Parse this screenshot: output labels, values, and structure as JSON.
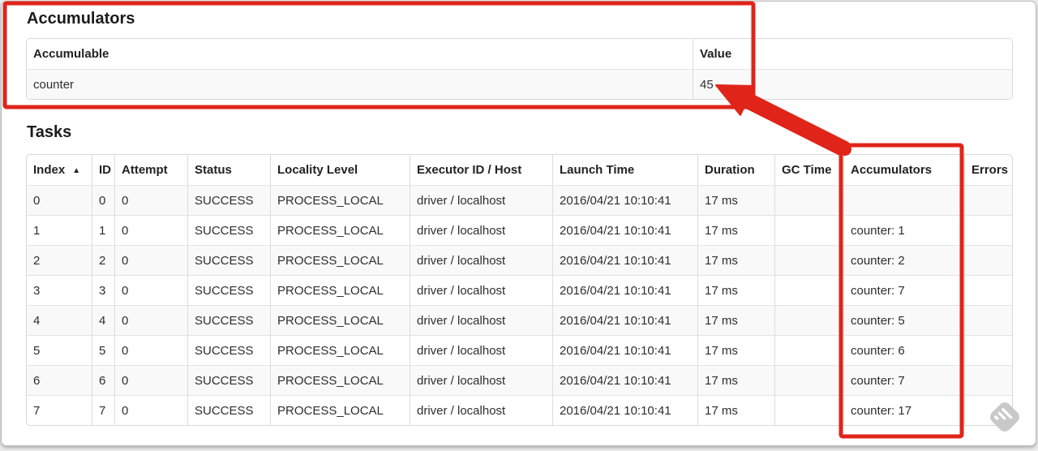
{
  "accumulators_section": {
    "title": "Accumulators",
    "table": {
      "headers": [
        "Accumulable",
        "Value"
      ],
      "rows": [
        [
          "counter",
          "45"
        ]
      ]
    }
  },
  "tasks_section": {
    "title": "Tasks",
    "table": {
      "headers": [
        "Index",
        "ID",
        "Attempt",
        "Status",
        "Locality Level",
        "Executor ID / Host",
        "Launch Time",
        "Duration",
        "GC Time",
        "Accumulators",
        "Errors"
      ],
      "sort": {
        "column": "Index",
        "indicator": "▲"
      },
      "rows": [
        [
          "0",
          "0",
          "0",
          "SUCCESS",
          "PROCESS_LOCAL",
          "driver / localhost",
          "2016/04/21 10:10:41",
          "17 ms",
          "",
          "",
          ""
        ],
        [
          "1",
          "1",
          "0",
          "SUCCESS",
          "PROCESS_LOCAL",
          "driver / localhost",
          "2016/04/21 10:10:41",
          "17 ms",
          "",
          "counter: 1",
          ""
        ],
        [
          "2",
          "2",
          "0",
          "SUCCESS",
          "PROCESS_LOCAL",
          "driver / localhost",
          "2016/04/21 10:10:41",
          "17 ms",
          "",
          "counter: 2",
          ""
        ],
        [
          "3",
          "3",
          "0",
          "SUCCESS",
          "PROCESS_LOCAL",
          "driver / localhost",
          "2016/04/21 10:10:41",
          "17 ms",
          "",
          "counter: 7",
          ""
        ],
        [
          "4",
          "4",
          "0",
          "SUCCESS",
          "PROCESS_LOCAL",
          "driver / localhost",
          "2016/04/21 10:10:41",
          "17 ms",
          "",
          "counter: 5",
          ""
        ],
        [
          "5",
          "5",
          "0",
          "SUCCESS",
          "PROCESS_LOCAL",
          "driver / localhost",
          "2016/04/21 10:10:41",
          "17 ms",
          "",
          "counter: 6",
          ""
        ],
        [
          "6",
          "6",
          "0",
          "SUCCESS",
          "PROCESS_LOCAL",
          "driver / localhost",
          "2016/04/21 10:10:41",
          "17 ms",
          "",
          "counter: 7",
          ""
        ],
        [
          "7",
          "7",
          "0",
          "SUCCESS",
          "PROCESS_LOCAL",
          "driver / localhost",
          "2016/04/21 10:10:41",
          "17 ms",
          "",
          "counter: 17",
          ""
        ]
      ]
    }
  },
  "annotations": {
    "accent_color": "#e02419"
  }
}
